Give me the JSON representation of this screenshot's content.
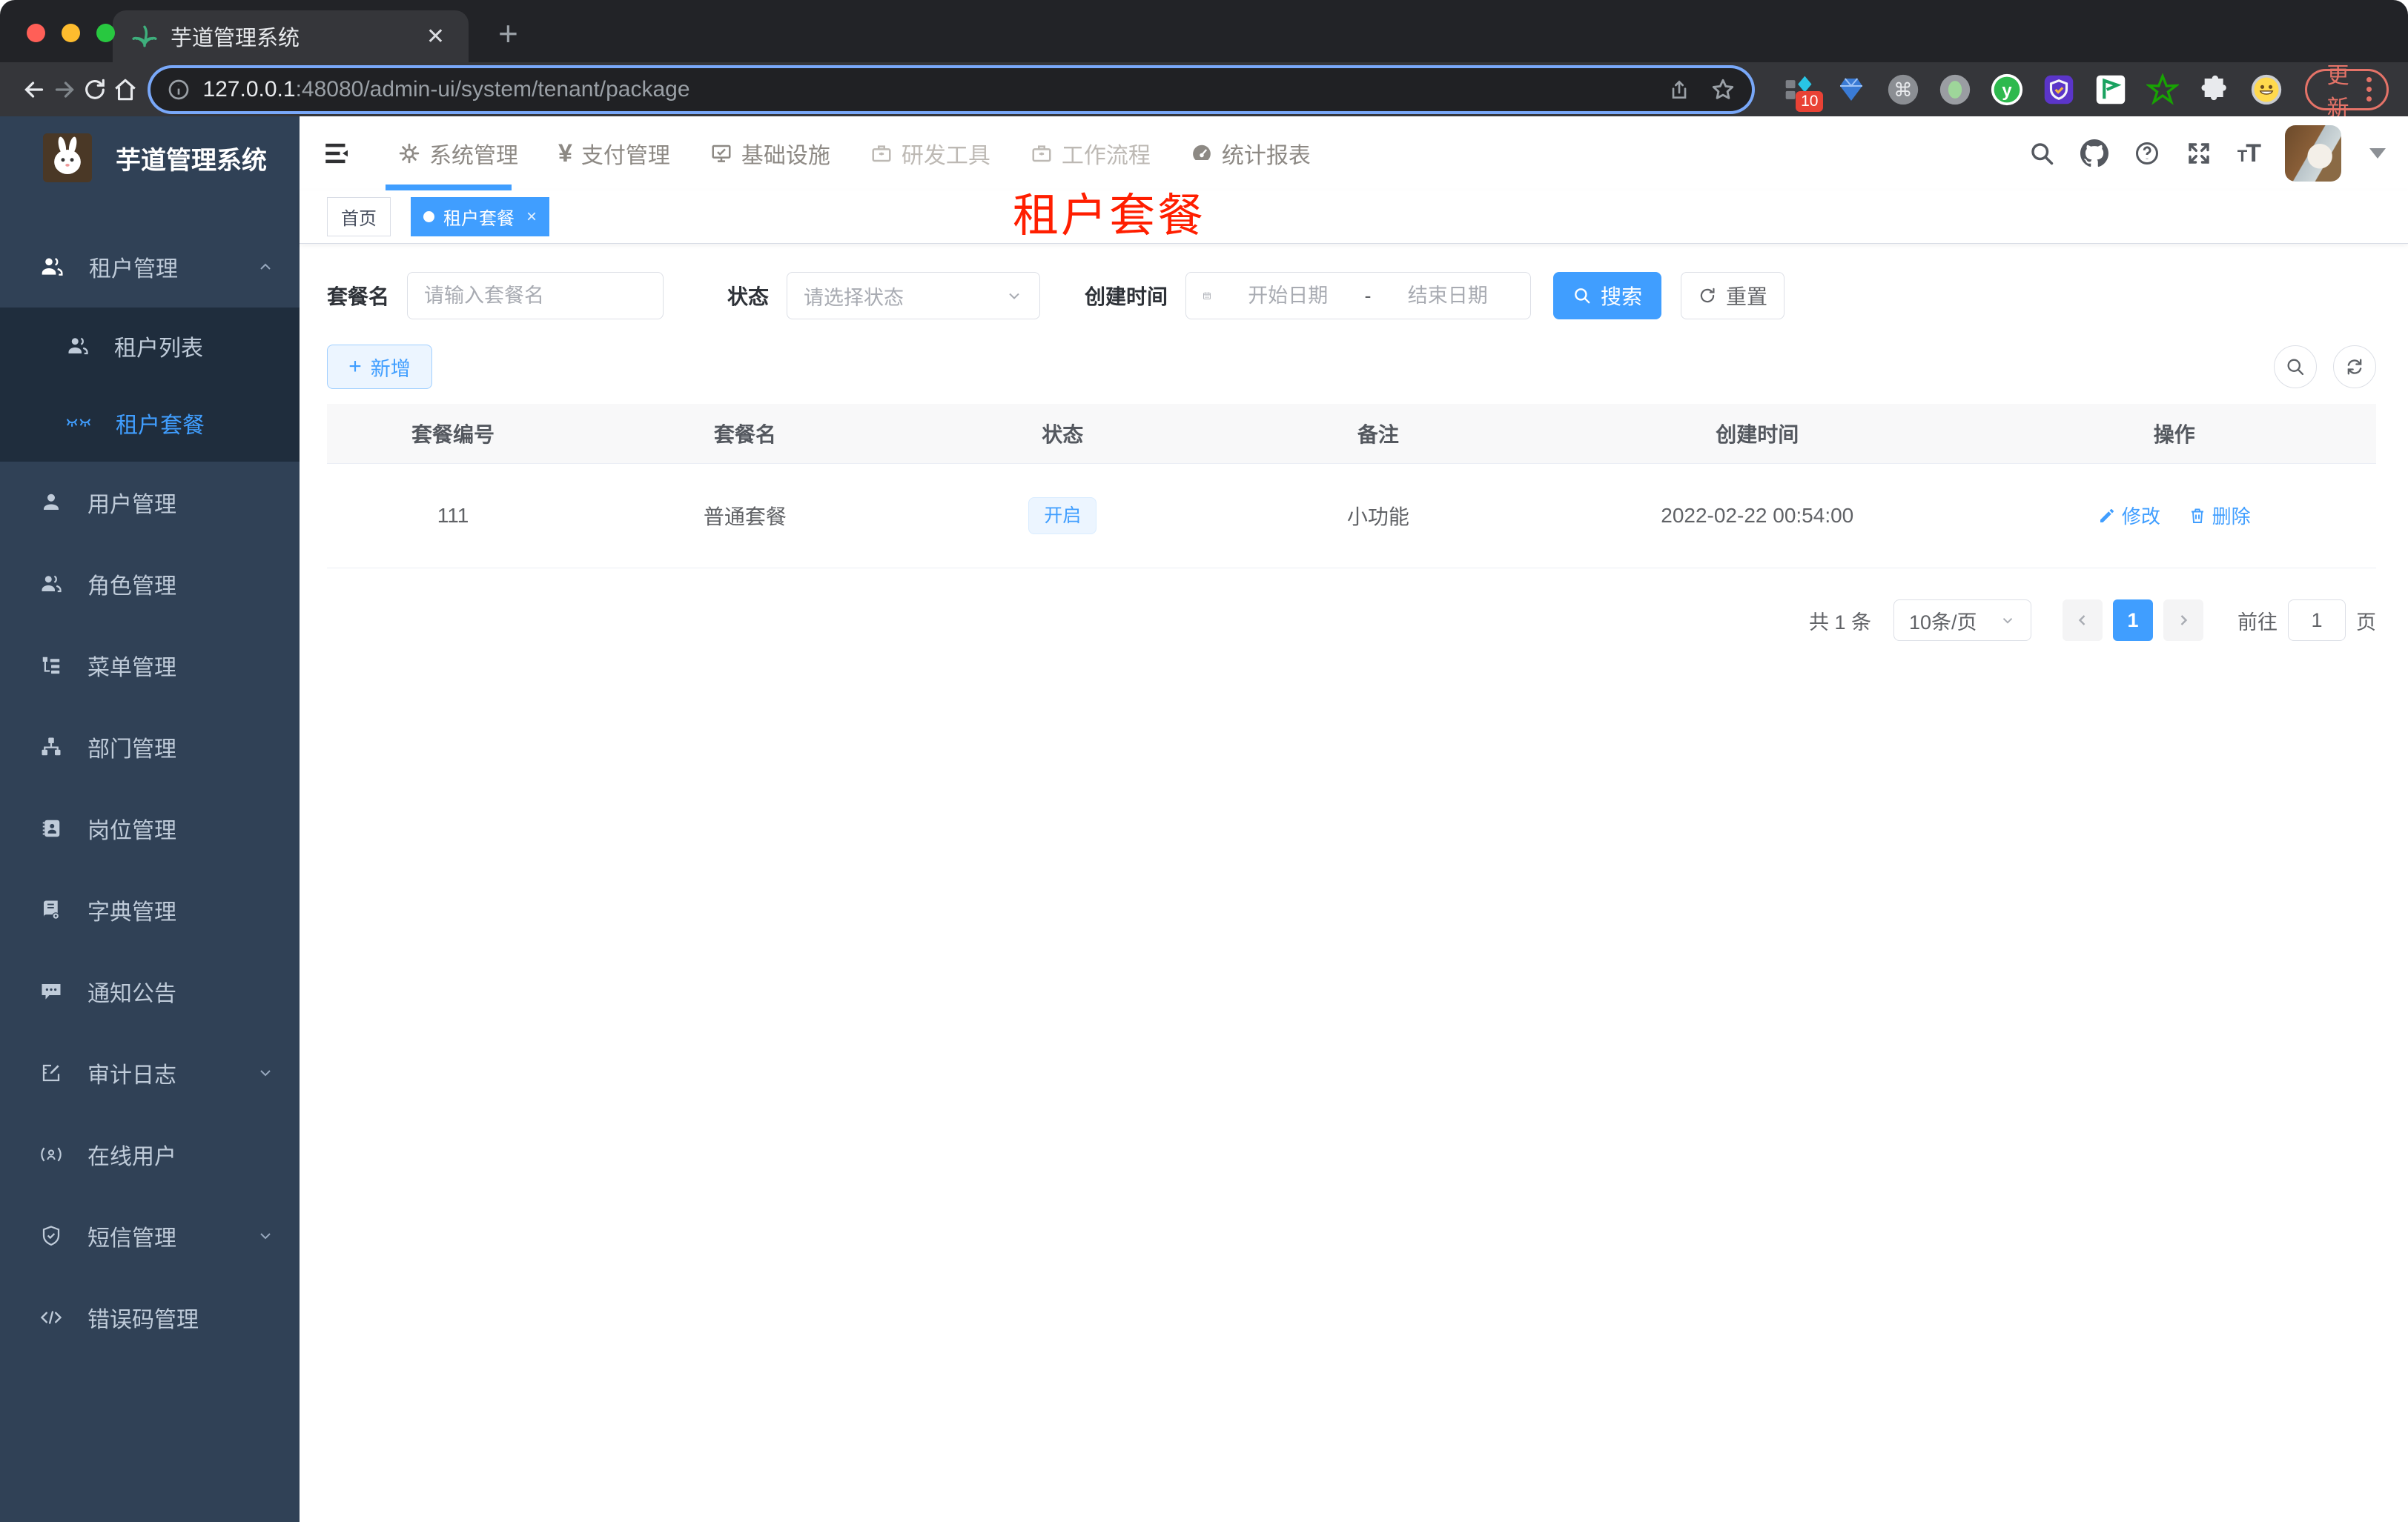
{
  "colors": {
    "accent": "#409eff",
    "annotation_red": "#ff1e00",
    "sidebar_bg": "#304156",
    "submenu_bg": "#1f2d3d"
  },
  "browser": {
    "tab_title": "芋道管理系统",
    "url_host": "127.0.0.1",
    "url_path": ":48080/admin-ui/system/tenant/package",
    "extension_badge": "10",
    "update_label": "更新"
  },
  "sidebar": {
    "app_title": "芋道管理系统",
    "items": [
      {
        "label": "租户管理"
      },
      {
        "label": "租户列表"
      },
      {
        "label": "租户套餐"
      },
      {
        "label": "用户管理"
      },
      {
        "label": "角色管理"
      },
      {
        "label": "菜单管理"
      },
      {
        "label": "部门管理"
      },
      {
        "label": "岗位管理"
      },
      {
        "label": "字典管理"
      },
      {
        "label": "通知公告"
      },
      {
        "label": "审计日志"
      },
      {
        "label": "在线用户"
      },
      {
        "label": "短信管理"
      },
      {
        "label": "错误码管理"
      }
    ]
  },
  "navbar": {
    "menus": [
      {
        "label": "系统管理"
      },
      {
        "label": "支付管理"
      },
      {
        "label": "基础设施"
      },
      {
        "label": "研发工具"
      },
      {
        "label": "工作流程"
      },
      {
        "label": "统计报表"
      }
    ]
  },
  "tags": {
    "home": "首页",
    "active": "租户套餐"
  },
  "annotation": "租户套餐",
  "filter": {
    "name_label": "套餐名",
    "name_placeholder": "请输入套餐名",
    "status_label": "状态",
    "status_placeholder": "请选择状态",
    "date_label": "创建时间",
    "date_start_placeholder": "开始日期",
    "date_separator": "-",
    "date_end_placeholder": "结束日期",
    "search_label": "搜索",
    "reset_label": "重置"
  },
  "actions": {
    "add_label": "新增"
  },
  "table": {
    "columns": [
      "套餐编号",
      "套餐名",
      "状态",
      "备注",
      "创建时间",
      "操作"
    ],
    "rows": [
      {
        "id": "111",
        "name": "普通套餐",
        "status": "开启",
        "remark": "小功能",
        "created": "2022-02-22 00:54:00",
        "edit": "修改",
        "delete": "删除"
      }
    ]
  },
  "pagination": {
    "total": "共 1 条",
    "page_size": "10条/页",
    "current": "1",
    "goto_label": "前往",
    "goto_value": "1",
    "goto_suffix": "页"
  }
}
